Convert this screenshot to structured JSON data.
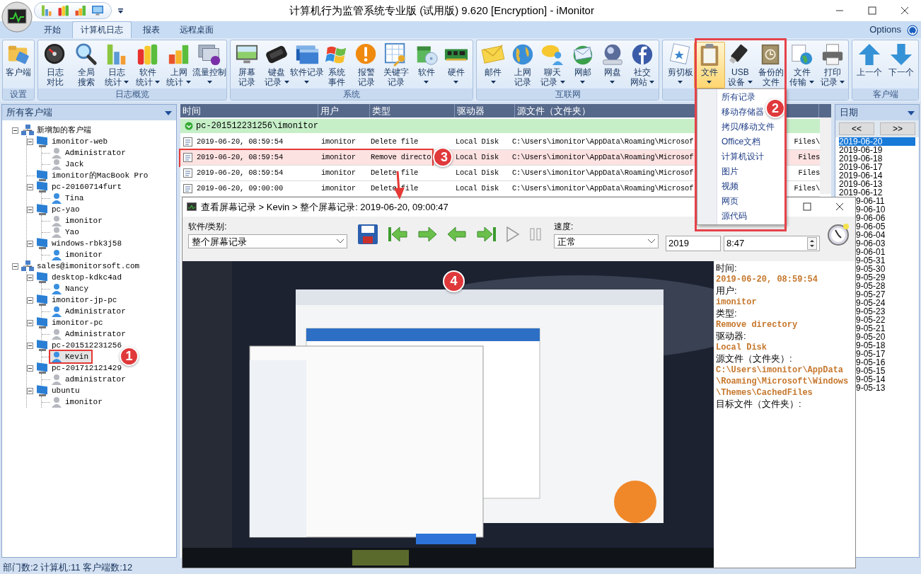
{
  "window": {
    "title": "计算机行为监管系统专业版 (试用版) 9.620 [Encryption] - iMonitor"
  },
  "ribbon_tabs": [
    {
      "label": "开始",
      "selected": false
    },
    {
      "label": "计算机日志",
      "selected": true
    },
    {
      "label": "报表",
      "selected": false
    },
    {
      "label": "远程桌面",
      "selected": false
    }
  ],
  "options_label": "Options",
  "ribbon_groups": [
    {
      "label": "设置",
      "buttons": [
        {
          "lines": [
            "客户端"
          ],
          "dropdown": false,
          "selected": false
        }
      ]
    },
    {
      "label": "日志概览",
      "buttons": [
        {
          "lines": [
            "日志",
            "对比"
          ],
          "dropdown": false,
          "selected": false
        },
        {
          "lines": [
            "全局",
            "搜索"
          ],
          "dropdown": false,
          "selected": false
        },
        {
          "lines": [
            "日志",
            "统计"
          ],
          "dropdown": true,
          "selected": false
        },
        {
          "lines": [
            "软件",
            "统计"
          ],
          "dropdown": true,
          "selected": false
        },
        {
          "lines": [
            "上网",
            "统计"
          ],
          "dropdown": true,
          "selected": false
        },
        {
          "lines": [
            "流量控制"
          ],
          "dropdown": true,
          "selected": false
        }
      ]
    },
    {
      "label": "系统",
      "buttons": [
        {
          "lines": [
            "屏幕",
            "记录"
          ],
          "dropdown": false,
          "selected": false
        },
        {
          "lines": [
            "键盘",
            "记录"
          ],
          "dropdown": true,
          "selected": false
        },
        {
          "lines": [
            "软件记录"
          ],
          "dropdown": true,
          "selected": false
        },
        {
          "lines": [
            "系统",
            "事件"
          ],
          "dropdown": false,
          "selected": false
        },
        {
          "lines": [
            "报警",
            "记录"
          ],
          "dropdown": false,
          "selected": false
        },
        {
          "lines": [
            "关键字",
            "记录"
          ],
          "dropdown": false,
          "selected": false
        },
        {
          "lines": [
            "软件"
          ],
          "dropdown": true,
          "selected": false
        },
        {
          "lines": [
            "硬件"
          ],
          "dropdown": true,
          "selected": false
        }
      ]
    },
    {
      "label": "互联网",
      "buttons": [
        {
          "lines": [
            "邮件"
          ],
          "dropdown": true,
          "selected": false
        },
        {
          "lines": [
            "上网",
            "记录"
          ],
          "dropdown": false,
          "selected": false
        },
        {
          "lines": [
            "聊天",
            "记录"
          ],
          "dropdown": true,
          "selected": false
        },
        {
          "lines": [
            "网邮"
          ],
          "dropdown": true,
          "selected": false
        },
        {
          "lines": [
            "网盘"
          ],
          "dropdown": true,
          "selected": false
        },
        {
          "lines": [
            "社交",
            "网站"
          ],
          "dropdown": true,
          "selected": false
        }
      ]
    },
    {
      "buttons": [
        {
          "lines": [
            "剪切板"
          ],
          "dropdown": true,
          "selected": false
        },
        {
          "lines": [
            "文件"
          ],
          "dropdown": true,
          "selected": true
        },
        {
          "lines": [
            "USB",
            "设备"
          ],
          "dropdown": true,
          "selected": false
        },
        {
          "lines": [
            "备份的",
            "文件"
          ],
          "dropdown": false,
          "selected": false
        },
        {
          "lines": [
            "文件",
            "传输"
          ],
          "dropdown": true,
          "selected": false
        },
        {
          "lines": [
            "打印",
            "记录"
          ],
          "dropdown": true,
          "selected": false
        }
      ]
    },
    {
      "label": "客户端",
      "buttons": [
        {
          "lines": [
            "上一个"
          ],
          "dropdown": false,
          "selected": false
        },
        {
          "lines": [
            "下一个"
          ],
          "dropdown": false,
          "selected": false
        }
      ]
    }
  ],
  "clients_panel": {
    "title": "所有客户端",
    "tree": [
      {
        "label": "新增加的客户端",
        "kind": "group",
        "expanded": true,
        "selected": false,
        "children": [
          {
            "label": "imonitor-web",
            "kind": "computer",
            "expanded": true,
            "selected": false,
            "children": [
              {
                "label": "Administrator",
                "kind": "user",
                "online": false,
                "selected": false
              },
              {
                "label": "Jack",
                "kind": "user",
                "online": false,
                "selected": false
              }
            ]
          },
          {
            "label": "imonitor的MacBook Pro",
            "kind": "computer",
            "selected": false
          },
          {
            "label": "pc-20160714furt",
            "kind": "computer",
            "expanded": true,
            "selected": false,
            "children": [
              {
                "label": "Tina",
                "kind": "user",
                "online": true,
                "selected": false
              }
            ]
          },
          {
            "label": "pc-yao",
            "kind": "computer",
            "expanded": true,
            "selected": false,
            "children": [
              {
                "label": "imonitor",
                "kind": "user",
                "online": false,
                "selected": false
              },
              {
                "label": "Yao",
                "kind": "user",
                "online": false,
                "selected": false
              }
            ]
          },
          {
            "label": "windows-rbk3j58",
            "kind": "computer",
            "expanded": true,
            "selected": false,
            "children": [
              {
                "label": "imonitor",
                "kind": "user",
                "online": true,
                "selected": false
              }
            ]
          }
        ]
      },
      {
        "label": "sales@imonitorsoft.com",
        "kind": "group",
        "expanded": true,
        "selected": false,
        "children": [
          {
            "label": "desktop-kdkc4ad",
            "kind": "computer",
            "expanded": true,
            "selected": false,
            "children": [
              {
                "label": "Nancy",
                "kind": "user",
                "online": true,
                "selected": false
              }
            ]
          },
          {
            "label": "imonitor-jp-pc",
            "kind": "computer",
            "expanded": true,
            "selected": false,
            "children": [
              {
                "label": "Administrator",
                "kind": "user",
                "online": true,
                "selected": false
              }
            ]
          },
          {
            "label": "imonitor-pc",
            "kind": "computer",
            "expanded": true,
            "selected": false,
            "children": [
              {
                "label": "Administrator",
                "kind": "user",
                "online": false,
                "selected": false
              }
            ]
          },
          {
            "label": "pc-201512231256",
            "kind": "computer",
            "expanded": true,
            "selected": false,
            "children": [
              {
                "label": "Kevin",
                "kind": "user",
                "online": true,
                "selected": true,
                "highlighted": true,
                "callout": "1"
              }
            ]
          },
          {
            "label": "pc-201712121429",
            "kind": "computer",
            "expanded": true,
            "selected": false,
            "children": [
              {
                "label": "administrator",
                "kind": "user",
                "online": false,
                "selected": false
              }
            ]
          },
          {
            "label": "ubuntu",
            "kind": "computer",
            "expanded": true,
            "selected": false,
            "children": [
              {
                "label": "imonitor",
                "kind": "user",
                "online": false,
                "selected": false
              }
            ]
          }
        ]
      }
    ]
  },
  "table": {
    "columns": [
      "时间",
      "用户",
      "类型",
      "驱动器",
      "源文件（文件夹）"
    ],
    "group_row": "pc-201512231256\\imonitor",
    "rows": [
      {
        "time": "2019-06-20, 08:59:54",
        "user": "imonitor",
        "type": "Delete file",
        "drive": "Local Disk",
        "source": "C:\\Users\\imonitor\\AppData\\Roaming\\Microsof",
        "source_tail": "Files\\",
        "selected": false
      },
      {
        "time": "2019-06-20, 08:59:54",
        "user": "imonitor",
        "type": "Remove directo",
        "drive": "Local Disk",
        "source": "C:\\Users\\imonitor\\AppData\\Roaming\\Microsof",
        "source_tail": "Files",
        "selected": true,
        "highlighted": true,
        "callout": "3"
      },
      {
        "time": "2019-06-20, 08:59:54",
        "user": "imonitor",
        "type": "Delete file",
        "drive": "Local Disk",
        "source": "C:\\Users\\imonitor\\AppData\\Roaming\\Microsof",
        "source_tail": "Files",
        "selected": false
      },
      {
        "time": "2019-06-20, 09:00:00",
        "user": "imonitor",
        "type": "Delete file",
        "drive": "Local Disk",
        "source": "C:\\Users\\imonitor\\AppData\\Roaming\\Microsof",
        "source_tail": "Files\\",
        "selected": false
      }
    ]
  },
  "file_menu": {
    "highlighted": true,
    "callout": "2",
    "items": [
      "所有记录",
      "移动存储器",
      "拷贝/移动文件",
      "Office文档",
      "计算机设计",
      "图片",
      "视频",
      "网页",
      "源代码"
    ]
  },
  "date_panel": {
    "title": "日期",
    "prev_label": "<<",
    "next_label": ">>",
    "dates": [
      {
        "label": "2019-06-20",
        "selected": true
      },
      {
        "label": "2019-06-19",
        "selected": false
      },
      {
        "label": "2019-06-18",
        "selected": false
      },
      {
        "label": "2019-06-17",
        "selected": false
      },
      {
        "label": "2019-06-14",
        "selected": false
      },
      {
        "label": "2019-06-13",
        "selected": false
      },
      {
        "label": "2019-06-12",
        "selected": false
      },
      {
        "label": "9-06-11",
        "selected": false
      },
      {
        "label": "9-06-10",
        "selected": false
      },
      {
        "label": "9-06-06",
        "selected": false
      },
      {
        "label": "9-06-05",
        "selected": false
      },
      {
        "label": "9-06-04",
        "selected": false
      },
      {
        "label": "9-06-03",
        "selected": false
      },
      {
        "label": "9-06-01",
        "selected": false
      },
      {
        "label": "9-05-31",
        "selected": false
      },
      {
        "label": "9-05-30",
        "selected": false
      },
      {
        "label": "9-05-29",
        "selected": false
      },
      {
        "label": "9-05-28",
        "selected": false
      },
      {
        "label": "9-05-27",
        "selected": false
      },
      {
        "label": "9-05-24",
        "selected": false
      },
      {
        "label": "9-05-23",
        "selected": false
      },
      {
        "label": "9-05-22",
        "selected": false
      },
      {
        "label": "9-05-21",
        "selected": false
      },
      {
        "label": "9-05-20",
        "selected": false
      },
      {
        "label": "9-05-18",
        "selected": false
      },
      {
        "label": "9-05-17",
        "selected": false
      },
      {
        "label": "9-05-16",
        "selected": false
      },
      {
        "label": "9-05-15",
        "selected": false
      },
      {
        "label": "9-05-14",
        "selected": false
      },
      {
        "label": "9-05-13",
        "selected": false
      }
    ]
  },
  "viewer": {
    "title": "查看屏幕记录 > Kevin > 整个屏幕记录: 2019-06-20, 09:00:47",
    "pointer_arrow": true,
    "category_label": "软件/类别:",
    "category_value": "整个屏幕记录",
    "speed_label": "速度:",
    "speed_value": "正常",
    "date_value": "2019",
    "time_value": "8:47",
    "screen": {
      "kind": "picture",
      "callout": "4"
    },
    "details": [
      {
        "label": "时间:",
        "value": "2019-06-20, 08:59:54"
      },
      {
        "label": "用户:",
        "value": "imonitor"
      },
      {
        "label": "类型:",
        "value": "Remove directory"
      },
      {
        "label": "驱动器:",
        "value": "Local Disk"
      },
      {
        "label": "源文件（文件夹）:",
        "value": "C:\\Users\\imonitor\\AppData\\Roaming\\Microsoft\\Windows\\Themes\\CachedFiles"
      },
      {
        "label": "目标文件（文件夹）:"
      }
    ]
  },
  "status_bar": "部门数:2 计算机:11 客户端数:12"
}
